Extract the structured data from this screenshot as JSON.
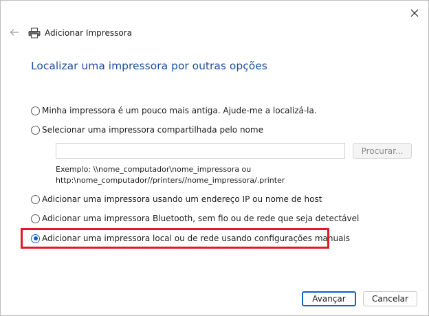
{
  "window": {
    "title": "Adicionar Impressora",
    "heading": "Localizar uma impressora por outras opções"
  },
  "options": [
    {
      "label": "Minha impressora é um pouco mais antiga. Ajude-me a localizá-la.",
      "checked": false
    },
    {
      "label": "Selecionar uma impressora compartilhada pelo nome",
      "checked": false
    },
    {
      "label": "Adicionar uma impressora usando um endereço IP ou nome de host",
      "checked": false
    },
    {
      "label": "Adicionar uma impressora Bluetooth, sem fio ou de rede que seja detectável",
      "checked": false
    },
    {
      "label": "Adicionar uma impressora local ou de rede usando configurações manuais",
      "checked": true
    }
  ],
  "share": {
    "value": "",
    "browse_label": "Procurar...",
    "example_line1": "Exemplo: \\\\nome_computador\\nome_impressora ou",
    "example_line2": "http:\\nome_computador//printers//nome_impressora/.printer"
  },
  "buttons": {
    "next": "Avançar",
    "cancel": "Cancelar"
  },
  "colors": {
    "accent": "#0f62c4",
    "heading": "#1c4f9c",
    "highlight": "#e0182a"
  }
}
